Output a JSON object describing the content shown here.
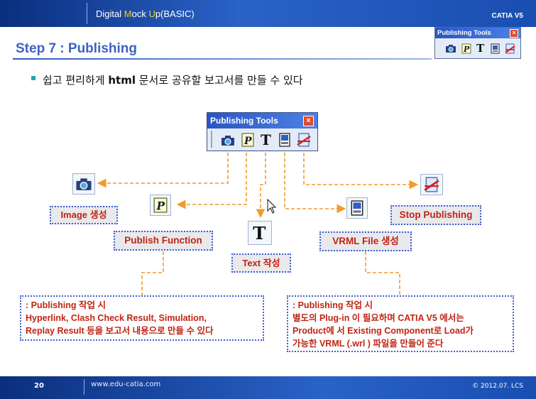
{
  "header": {
    "title_parts": [
      "Digital ",
      "M",
      "ock ",
      "U",
      "p(BASIC)"
    ],
    "right": "CATIA V5"
  },
  "step_title": "Step 7 : Publishing",
  "lead": {
    "before": "쉽고 편리하게 ",
    "bold": "html",
    "after": " 문서로 공유할 보고서를 만들 수 있다"
  },
  "toolbar": {
    "title": "Publishing Tools",
    "close": "×"
  },
  "labels": {
    "image": "Image 생성",
    "publish": "Publish Function",
    "text": "Text 작성",
    "vrml": "VRML File 생성",
    "stop": "Stop Publishing"
  },
  "note_left": {
    "lines": [
      ": Publishing 작업 시",
      "Hyperlink, Clash Check Result, Simulation,",
      "Replay Result 등을 보고서 내용으로 만들 수 있다"
    ]
  },
  "note_right": {
    "lines": [
      ": Publishing 작업 시",
      "별도의 Plug-in 이 필요하며 CATIA V5 에서는",
      "Product에 서 Existing Component로 Load가",
      "가능한 VRML (.wrl ) 파일을 만들어 준다"
    ]
  },
  "footer": {
    "page": "20",
    "url": "www.edu-catia.com",
    "copyright": "© 2012.07. LCS"
  },
  "icons": [
    "camera-icon",
    "publish-p-icon",
    "text-t-icon",
    "vrml-file-icon",
    "stop-publishing-icon"
  ],
  "colors": {
    "accent": "#3c62c4",
    "label_red": "#c02414",
    "arrow_orange": "#f29a2e",
    "dotted_blue": "#3f5ed3"
  }
}
